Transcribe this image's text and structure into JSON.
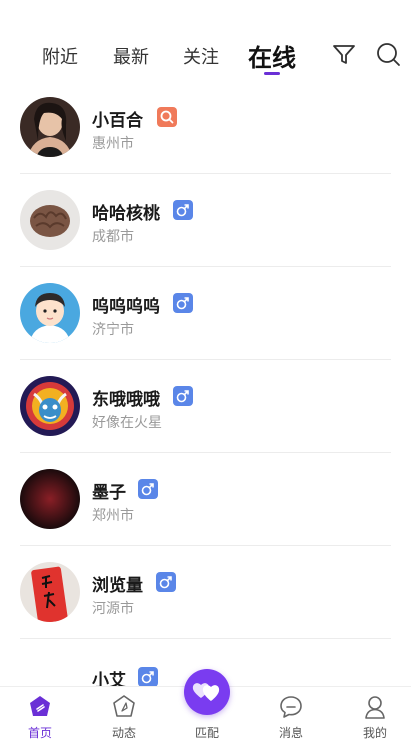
{
  "tabs": [
    {
      "label": "附近"
    },
    {
      "label": "最新"
    },
    {
      "label": "关注"
    },
    {
      "label": "在线"
    }
  ],
  "users": [
    {
      "name": "小百合",
      "city": "惠州市",
      "badge": "search-icon",
      "badge_color": "#f07a5a"
    },
    {
      "name": "哈哈核桃",
      "city": "成都市",
      "badge": "male-icon",
      "badge_color": "#5a86e8"
    },
    {
      "name": "呜呜呜呜",
      "city": "济宁市",
      "badge": "male-icon",
      "badge_color": "#5a86e8"
    },
    {
      "name": "东哦哦哦",
      "city": "好像在火星",
      "badge": "male-icon",
      "badge_color": "#5a86e8"
    },
    {
      "name": "墨子",
      "city": "郑州市",
      "badge": "male-icon",
      "badge_color": "#5a86e8"
    },
    {
      "name": "浏览量",
      "city": "河源市",
      "badge": "male-icon",
      "badge_color": "#5a86e8"
    },
    {
      "name": "小艾",
      "city": "",
      "badge": "male-icon",
      "badge_color": "#5a86e8"
    }
  ],
  "bottom_nav": [
    {
      "label": "首页",
      "icon": "home-icon"
    },
    {
      "label": "动态",
      "icon": "moments-icon"
    },
    {
      "label": "匹配",
      "icon": "match-heart-icon"
    },
    {
      "label": "消息",
      "icon": "message-icon"
    },
    {
      "label": "我的",
      "icon": "profile-icon"
    }
  ],
  "colors": {
    "accent": "#6a2fd6",
    "male_badge": "#5a86e8",
    "search_badge": "#f07a5a"
  }
}
